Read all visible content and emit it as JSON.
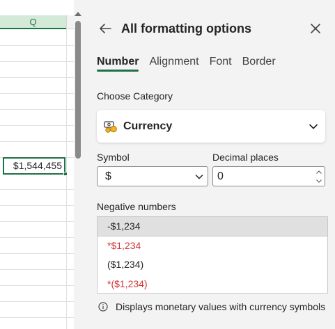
{
  "sheet": {
    "column_label": "Q",
    "selected_cell_value": "$1,544,455"
  },
  "pane": {
    "title": "All formatting options",
    "back_icon": "arrow-left-icon",
    "close_icon": "close-icon",
    "tabs": [
      {
        "label": "Number",
        "active": true
      },
      {
        "label": "Alignment",
        "active": false
      },
      {
        "label": "Font",
        "active": false
      },
      {
        "label": "Border",
        "active": false
      }
    ],
    "category": {
      "heading": "Choose Category",
      "selected": "Currency",
      "icon": "currency-icon"
    },
    "symbol": {
      "label": "Symbol",
      "value": "$"
    },
    "decimal": {
      "label": "Decimal places",
      "value": "0"
    },
    "negative_numbers": {
      "label": "Negative numbers",
      "options": [
        {
          "text": "-$1,234",
          "color": "#242424",
          "selected": true
        },
        {
          "text": "*$1,234",
          "color": "#d13438",
          "selected": false
        },
        {
          "text": "($1,234)",
          "color": "#242424",
          "selected": false
        },
        {
          "text": "*($1,234)",
          "color": "#d13438",
          "selected": false
        }
      ]
    },
    "info_text": "Displays monetary values with currency symbols"
  },
  "colors": {
    "accent": "#1e7145",
    "negative_red": "#d13438"
  }
}
